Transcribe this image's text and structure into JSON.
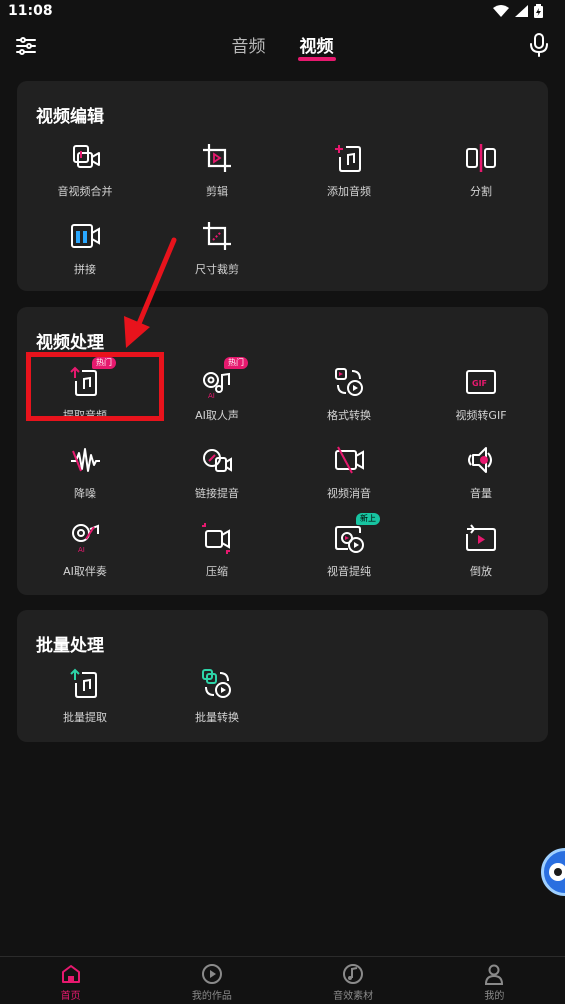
{
  "status": {
    "time": "11:08"
  },
  "header": {
    "tabs": [
      {
        "label": "音频"
      },
      {
        "label": "视频"
      }
    ],
    "active_tab": "视频"
  },
  "sections": [
    {
      "title": "视频编辑",
      "tools": [
        {
          "label": "音视频合并",
          "icon": "av-merge-icon"
        },
        {
          "label": "剪辑",
          "icon": "crop-icon"
        },
        {
          "label": "添加音频",
          "icon": "add-audio-icon"
        },
        {
          "label": "分割",
          "icon": "split-icon"
        },
        {
          "label": "拼接",
          "icon": "join-icon"
        },
        {
          "label": "尺寸裁剪",
          "icon": "resize-crop-icon"
        }
      ]
    },
    {
      "title": "视频处理",
      "tools": [
        {
          "label": "提取音频",
          "icon": "extract-audio-icon",
          "badge": "热门"
        },
        {
          "label": "AI取人声",
          "icon": "ai-vocal-icon",
          "badge": "热门"
        },
        {
          "label": "格式转换",
          "icon": "format-convert-icon"
        },
        {
          "label": "视频转GIF",
          "icon": "gif-icon"
        },
        {
          "label": "降噪",
          "icon": "denoise-icon"
        },
        {
          "label": "链接提音",
          "icon": "link-extract-icon"
        },
        {
          "label": "视频消音",
          "icon": "mute-icon"
        },
        {
          "label": "音量",
          "icon": "volume-icon"
        },
        {
          "label": "AI取伴奏",
          "icon": "ai-accompaniment-icon"
        },
        {
          "label": "压缩",
          "icon": "compress-icon"
        },
        {
          "label": "视音提纯",
          "icon": "purify-icon",
          "badge": "新上"
        },
        {
          "label": "倒放",
          "icon": "reverse-icon"
        }
      ]
    },
    {
      "title": "批量处理",
      "tools": [
        {
          "label": "批量提取",
          "icon": "batch-extract-icon"
        },
        {
          "label": "批量转换",
          "icon": "batch-convert-icon"
        }
      ]
    }
  ],
  "nav": [
    {
      "label": "首页",
      "icon": "home-icon"
    },
    {
      "label": "我的作品",
      "icon": "works-icon"
    },
    {
      "label": "音效素材",
      "icon": "sound-material-icon"
    },
    {
      "label": "我的",
      "icon": "profile-icon"
    }
  ],
  "colors": {
    "accent": "#e6196e",
    "new_badge": "#17c4a1",
    "annotation": "#e8131c"
  }
}
